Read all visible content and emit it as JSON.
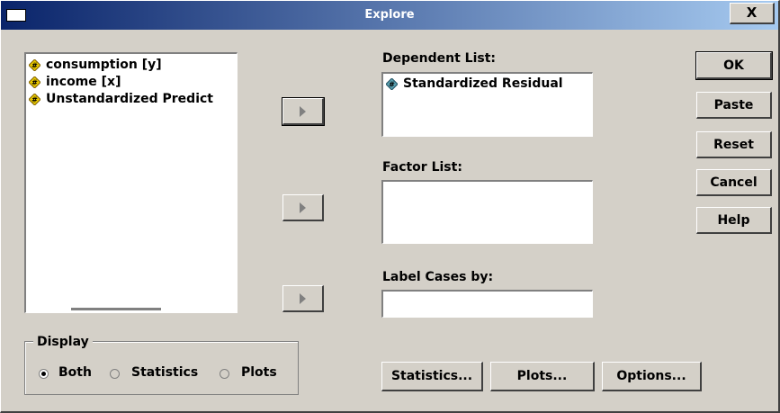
{
  "window": {
    "title": "Explore",
    "close_glyph": "X"
  },
  "source_list": {
    "items": [
      {
        "label": "consumption [y]",
        "icon": "scale-variable-icon"
      },
      {
        "label": "income [x]",
        "icon": "scale-variable-icon"
      },
      {
        "label": "Unstandardized Predict",
        "icon": "scale-variable-icon"
      }
    ]
  },
  "dependent_list": {
    "label": "Dependent List:",
    "items": [
      {
        "label": "Standardized Residual",
        "icon": "scale-variable-icon"
      }
    ]
  },
  "factor_list": {
    "label": "Factor List:"
  },
  "label_cases": {
    "label": "Label Cases by:"
  },
  "buttons": {
    "ok": "OK",
    "paste": "Paste",
    "reset": "Reset",
    "cancel": "Cancel",
    "help": "Help",
    "statistics": "Statistics...",
    "plots": "Plots...",
    "options": "Options..."
  },
  "display": {
    "legend": "Display",
    "options": [
      {
        "label": "Both",
        "selected": true
      },
      {
        "label": "Statistics",
        "selected": false
      },
      {
        "label": "Plots",
        "selected": false
      }
    ]
  },
  "colors": {
    "title_bar_start": "#0a246a",
    "title_bar_end": "#a6caf0",
    "dialog_face": "#d4d0c8",
    "variable_icon": "#e8c800"
  }
}
